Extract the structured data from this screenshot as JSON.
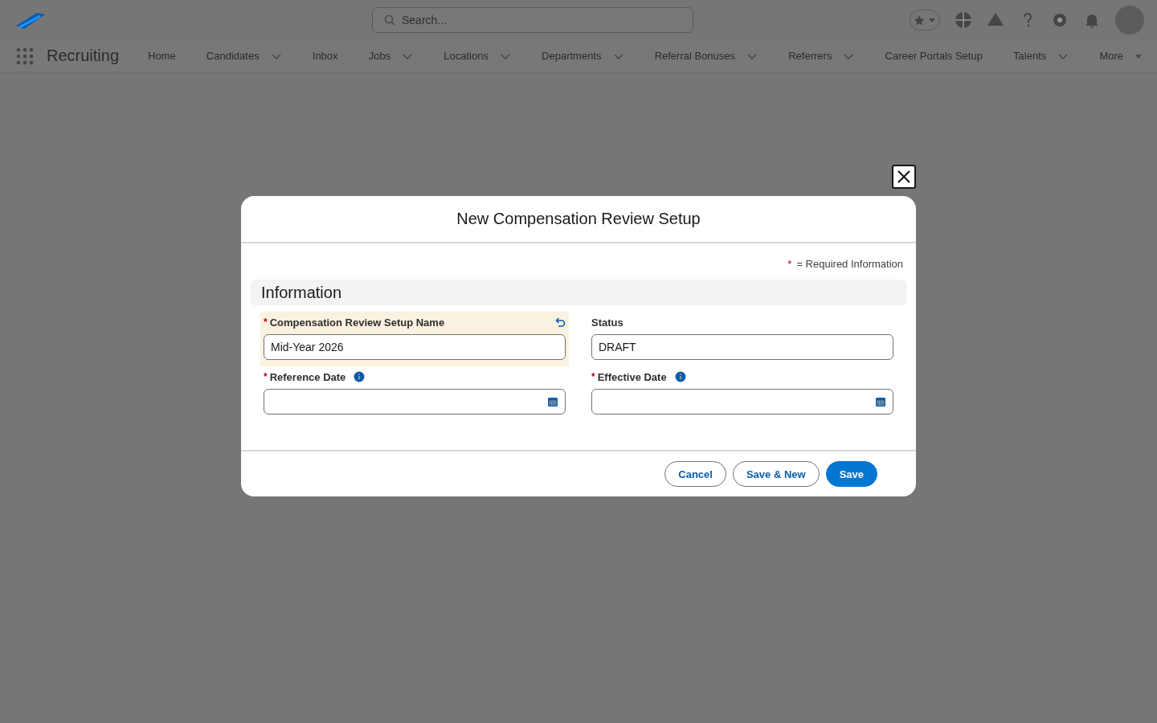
{
  "header": {
    "search": {
      "placeholder": "Search..."
    }
  },
  "nav": {
    "app_name": "Recruiting",
    "items": [
      {
        "label": "Home",
        "menu": false
      },
      {
        "label": "Candidates",
        "menu": true
      },
      {
        "label": "Inbox",
        "menu": false
      },
      {
        "label": "Jobs",
        "menu": true
      },
      {
        "label": "Locations",
        "menu": true
      },
      {
        "label": "Departments",
        "menu": true
      },
      {
        "label": "Referral Bonuses",
        "menu": true
      },
      {
        "label": "Referrers",
        "menu": true
      },
      {
        "label": "Career Portals Setup",
        "menu": false
      },
      {
        "label": "Talents",
        "menu": true
      }
    ],
    "more": {
      "label": "More"
    }
  },
  "modal": {
    "title": "New Compensation Review Setup",
    "required_note": {
      "mark": "*",
      "text": "= Required Information"
    },
    "section": "Information",
    "fields": [
      {
        "label": "Compensation Review Setup Name",
        "kind": "text",
        "required": true,
        "edited": true,
        "info": false,
        "value": "Mid-Year 2026"
      },
      {
        "label": "Status",
        "kind": "text",
        "required": false,
        "edited": false,
        "info": false,
        "value": "DRAFT"
      },
      {
        "label": "Reference Date",
        "kind": "date",
        "required": true,
        "edited": false,
        "info": true
      },
      {
        "label": "Effective Date",
        "kind": "date",
        "required": true,
        "edited": false,
        "info": true
      }
    ],
    "buttons": [
      {
        "label": "Cancel",
        "kind": "neutral"
      },
      {
        "label": "Save & New",
        "kind": "neutral"
      },
      {
        "label": "Save",
        "kind": "brand"
      }
    ]
  }
}
